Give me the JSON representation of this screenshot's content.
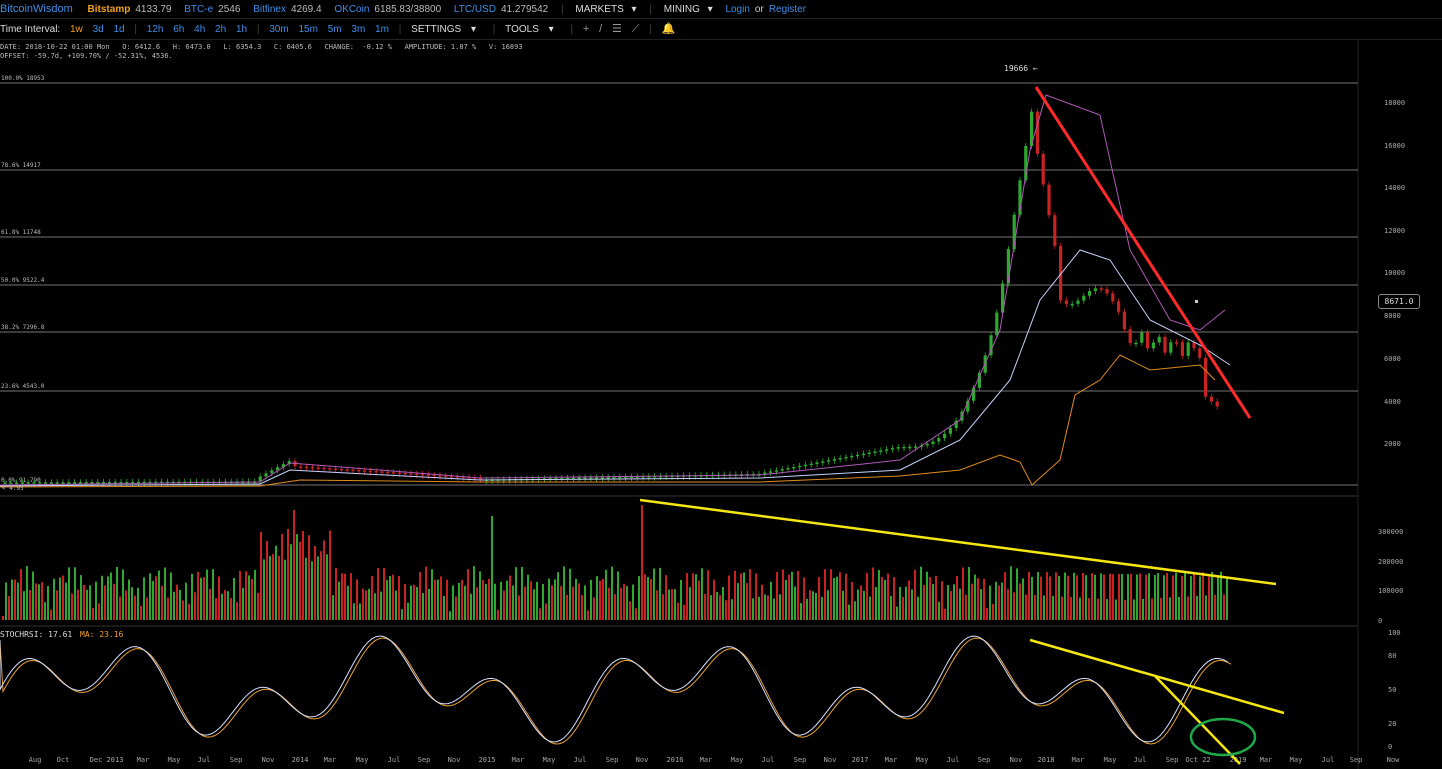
{
  "topbar": {
    "brand": "BitcoinWisdom",
    "tickers": [
      {
        "exchange": "Bitstamp",
        "price": "4133.79"
      },
      {
        "exchange": "BTC-e",
        "price": "2546"
      },
      {
        "exchange": "Bitfinex",
        "price": "4269.4"
      },
      {
        "exchange": "OKCoin",
        "price": "6185.83/38800"
      },
      {
        "exchange": "LTC/USD",
        "price": "41.279542"
      }
    ],
    "markets": "MARKETS",
    "mining": "MINING",
    "login": "Login",
    "or": "or",
    "register": "Register"
  },
  "toolbar": {
    "interval_label": "Time Interval:",
    "intervals": [
      "1w",
      "3d",
      "1d",
      "12h",
      "6h",
      "4h",
      "2h",
      "1h",
      "30m",
      "15m",
      "5m",
      "3m",
      "1m"
    ],
    "active_interval": "1w",
    "settings": "SETTINGS",
    "tools": "TOOLS"
  },
  "info": {
    "line1": "DATE: 2018-10-22 01:00 Mon   O: 6412.6   H: 6473.0   L: 6354.3   C: 6405.6   CHANGE:  -0.12 %   AMPLITUDE: 1.87 %   V: 16893",
    "line2": "OFFSET: -59.7d, +109.70% / -52.31%, 4536."
  },
  "fib_levels": [
    {
      "label": "100.0% 18953",
      "price": 18953
    },
    {
      "label": "78.6% 14917",
      "price": 14917
    },
    {
      "label": "61.8% 11748",
      "price": 11748
    },
    {
      "label": "50.0% 9522.4",
      "price": 9522.4
    },
    {
      "label": "38.2% 7296.8",
      "price": 7296.8
    },
    {
      "label": "23.6% 4543.0",
      "price": 4543.0
    },
    {
      "label": "0.0% 91.790",
      "price": 91.79
    }
  ],
  "extra_label": "< 4.95",
  "peak_label": "19666 ←",
  "current_price_box": "8671.0",
  "price_axis": [
    "18000",
    "16000",
    "14000",
    "12000",
    "10000",
    "8000",
    "6000",
    "4000",
    "2000"
  ],
  "volume_axis": [
    "300000",
    "200000",
    "100000",
    "0"
  ],
  "stochrsi": {
    "label": "STOCHRSI: 17.61",
    "ma_label": "MA: 23.16",
    "axis": [
      "100",
      "80",
      "50",
      "20",
      "0"
    ]
  },
  "x_axis": [
    "Aug",
    "Oct",
    "Dec",
    "2013",
    "Mar",
    "May",
    "Jul",
    "Sep",
    "Nov",
    "2014",
    "Mar",
    "May",
    "Jul",
    "Sep",
    "Nov",
    "2015",
    "Mar",
    "May",
    "Jul",
    "Sep",
    "Nov",
    "2016",
    "Mar",
    "May",
    "Jul",
    "Sep",
    "Nov",
    "2017",
    "Mar",
    "May",
    "Jul",
    "Sep",
    "Nov",
    "2018",
    "Mar",
    "May",
    "Jul",
    "Sep",
    "Oct 22",
    "2019",
    "Mar",
    "May",
    "Jul",
    "Sep",
    "Now"
  ],
  "colors": {
    "up": "#2ea82e",
    "down": "#c82222",
    "trend_red": "#ff2a2a",
    "trend_yellow": "#f5e614",
    "circle": "#1fa84a",
    "accent": "#3d8ee8",
    "active": "#f0a020"
  }
}
